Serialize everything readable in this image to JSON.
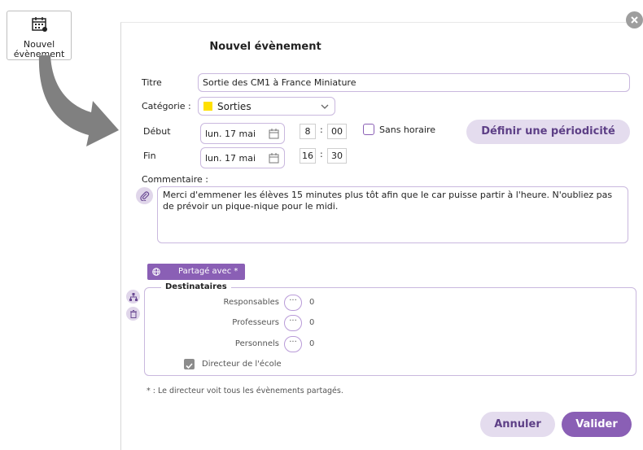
{
  "launcher": {
    "label": "Nouvel évènement",
    "icon": "calendar-add-icon"
  },
  "dialog": {
    "title": "Nouvel évènement",
    "titre": {
      "label": "Titre",
      "value": "Sortie des CM1 à France Miniature"
    },
    "categorie": {
      "label": "Catégorie :",
      "value": "Sorties",
      "color": "#ffe000"
    },
    "debut": {
      "label": "Début",
      "date": "lun. 17 mai",
      "hour": "8",
      "minute": "00"
    },
    "fin": {
      "label": "Fin",
      "date": "lun. 17 mai",
      "hour": "16",
      "minute": "30"
    },
    "sans_horaire": {
      "label": "Sans horaire",
      "checked": false
    },
    "periodicite_button": "Définir une périodicité",
    "commentaire": {
      "label": "Commentaire :",
      "value": "Merci d'emmener les élèves 15 minutes plus tôt afin que le car puisse partir à l'heure. N'oubliez pas de prévoir un pique-nique pour le midi."
    },
    "partage_button": "Partagé avec *",
    "destinataires": {
      "legend": "Destinataires",
      "rows": [
        {
          "label": "Responsables",
          "count": "0"
        },
        {
          "label": "Professeurs",
          "count": "0"
        },
        {
          "label": "Personnels",
          "count": "0"
        }
      ],
      "directeur": {
        "label": "Directeur de l'école",
        "checked": true
      }
    },
    "footnote": "* : Le directeur voit tous les évènements partagés.",
    "cancel_button": "Annuler",
    "validate_button": "Valider",
    "colors": {
      "accent": "#8a5fb5",
      "accent_light": "#e4dcee",
      "border": "#c9b8de"
    }
  }
}
